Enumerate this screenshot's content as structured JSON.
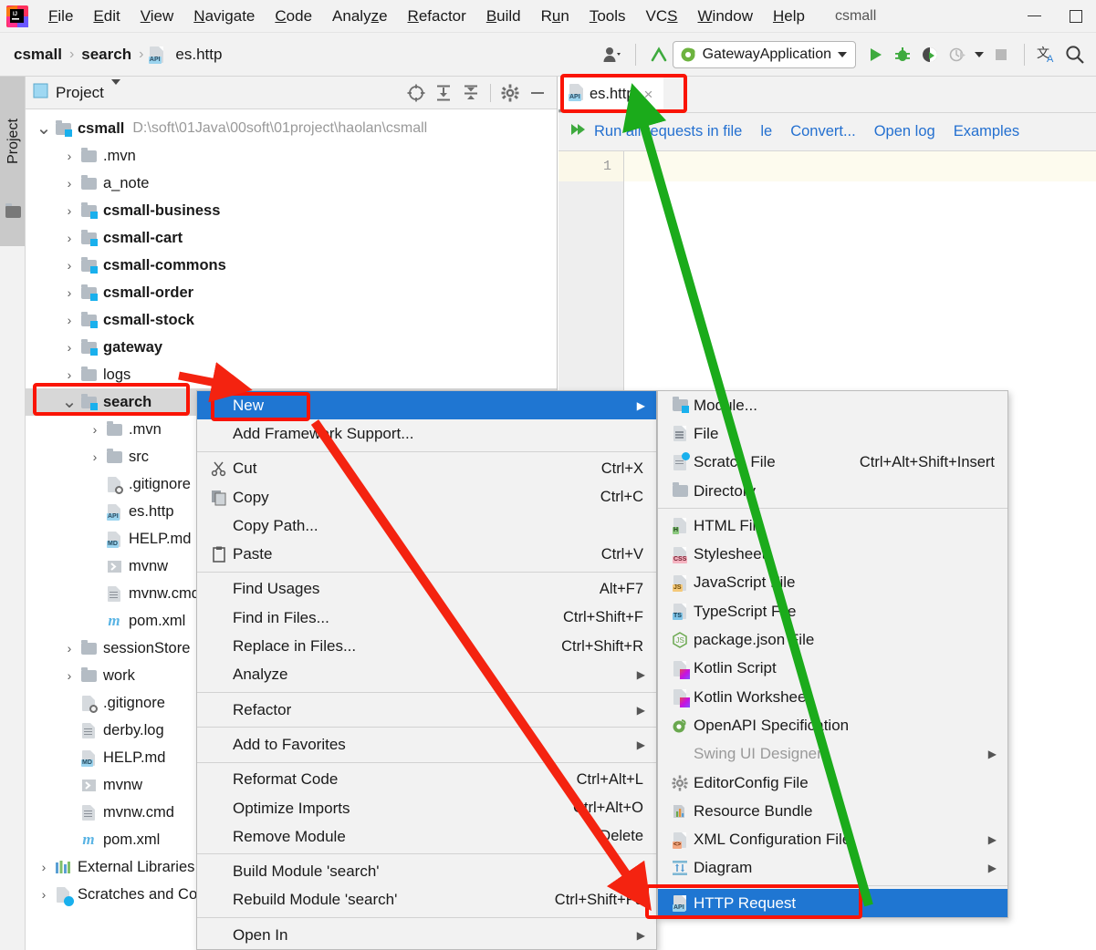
{
  "window": {
    "project_name": "csmall",
    "minimize_label": "—",
    "maximize_label": "□"
  },
  "menubar": {
    "items": [
      {
        "label": "File",
        "mnemonic": "F"
      },
      {
        "label": "Edit",
        "mnemonic": "E"
      },
      {
        "label": "View",
        "mnemonic": "V"
      },
      {
        "label": "Navigate",
        "mnemonic": "N"
      },
      {
        "label": "Code",
        "mnemonic": "C"
      },
      {
        "label": "Analyze",
        "mnemonic": "z"
      },
      {
        "label": "Refactor",
        "mnemonic": "R"
      },
      {
        "label": "Build",
        "mnemonic": "B"
      },
      {
        "label": "Run",
        "mnemonic": "u"
      },
      {
        "label": "Tools",
        "mnemonic": "T"
      },
      {
        "label": "VCS",
        "mnemonic": "S"
      },
      {
        "label": "Window",
        "mnemonic": "W"
      },
      {
        "label": "Help",
        "mnemonic": "H"
      }
    ]
  },
  "navbar": {
    "breadcrumb": [
      "csmall",
      "search",
      "es.http"
    ],
    "breadcrumb_separator": "›",
    "run_config": "GatewayApplication",
    "icons": {
      "profile": "profile-icon",
      "update": "update-project-icon",
      "run": "run-icon",
      "debug": "debug-icon",
      "run_coverage": "run-with-coverage-icon",
      "profiler": "profiler-icon",
      "stop": "stop-icon",
      "translate": "translate-icon",
      "search": "search-everywhere-icon"
    }
  },
  "toolstrip": {
    "project_label": "Project"
  },
  "project_panel": {
    "title": "Project",
    "header_icons": [
      "locate-icon",
      "expand-all-icon",
      "collapse-all-icon",
      "settings-gear-icon",
      "hide-icon"
    ],
    "tree": [
      {
        "depth": 0,
        "twist": "⌄",
        "icon": "module-folder",
        "label": "csmall",
        "bold": true,
        "path": "D:\\soft\\01Java\\00soft\\01project\\haolan\\csmall"
      },
      {
        "depth": 1,
        "twist": "›",
        "icon": "folder",
        "label": ".mvn",
        "bold": false,
        "path": ""
      },
      {
        "depth": 1,
        "twist": "›",
        "icon": "folder",
        "label": "a_note",
        "bold": false,
        "path": ""
      },
      {
        "depth": 1,
        "twist": "›",
        "icon": "module-folder",
        "label": "csmall-business",
        "bold": true,
        "path": ""
      },
      {
        "depth": 1,
        "twist": "›",
        "icon": "module-folder",
        "label": "csmall-cart",
        "bold": true,
        "path": ""
      },
      {
        "depth": 1,
        "twist": "›",
        "icon": "module-folder",
        "label": "csmall-commons",
        "bold": true,
        "path": ""
      },
      {
        "depth": 1,
        "twist": "›",
        "icon": "module-folder",
        "label": "csmall-order",
        "bold": true,
        "path": ""
      },
      {
        "depth": 1,
        "twist": "›",
        "icon": "module-folder",
        "label": "csmall-stock",
        "bold": true,
        "path": ""
      },
      {
        "depth": 1,
        "twist": "›",
        "icon": "module-folder",
        "label": "gateway",
        "bold": true,
        "path": ""
      },
      {
        "depth": 1,
        "twist": "›",
        "icon": "folder",
        "label": "logs",
        "bold": false,
        "path": ""
      },
      {
        "depth": 1,
        "twist": "⌄",
        "icon": "module-folder",
        "label": "search",
        "bold": true,
        "path": "",
        "selected": true
      },
      {
        "depth": 2,
        "twist": "›",
        "icon": "folder",
        "label": ".mvn",
        "bold": false,
        "path": ""
      },
      {
        "depth": 2,
        "twist": "›",
        "icon": "folder",
        "label": "src",
        "bold": false,
        "path": ""
      },
      {
        "depth": 2,
        "twist": "",
        "icon": "gitignore-file",
        "label": ".gitignore",
        "bold": false,
        "path": ""
      },
      {
        "depth": 2,
        "twist": "",
        "icon": "http-file",
        "label": "es.http",
        "bold": false,
        "path": ""
      },
      {
        "depth": 2,
        "twist": "",
        "icon": "md-file",
        "label": "HELP.md",
        "bold": false,
        "path": ""
      },
      {
        "depth": 2,
        "twist": "",
        "icon": "shell-file",
        "label": "mvnw",
        "bold": false,
        "path": ""
      },
      {
        "depth": 2,
        "twist": "",
        "icon": "text-file",
        "label": "mvnw.cmd",
        "bold": false,
        "path": ""
      },
      {
        "depth": 2,
        "twist": "",
        "icon": "maven-file",
        "label": "pom.xml",
        "bold": false,
        "path": ""
      },
      {
        "depth": 1,
        "twist": "›",
        "icon": "folder",
        "label": "sessionStore",
        "bold": false,
        "path": ""
      },
      {
        "depth": 1,
        "twist": "›",
        "icon": "folder",
        "label": "work",
        "bold": false,
        "path": ""
      },
      {
        "depth": 1,
        "twist": "",
        "icon": "gitignore-file",
        "label": ".gitignore",
        "bold": false,
        "path": ""
      },
      {
        "depth": 1,
        "twist": "",
        "icon": "text-file",
        "label": "derby.log",
        "bold": false,
        "path": ""
      },
      {
        "depth": 1,
        "twist": "",
        "icon": "md-file",
        "label": "HELP.md",
        "bold": false,
        "path": ""
      },
      {
        "depth": 1,
        "twist": "",
        "icon": "shell-file",
        "label": "mvnw",
        "bold": false,
        "path": ""
      },
      {
        "depth": 1,
        "twist": "",
        "icon": "text-file",
        "label": "mvnw.cmd",
        "bold": false,
        "path": ""
      },
      {
        "depth": 1,
        "twist": "",
        "icon": "maven-file",
        "label": "pom.xml",
        "bold": false,
        "path": ""
      },
      {
        "depth": 0,
        "twist": "›",
        "icon": "libraries",
        "label": "External Libraries",
        "bold": false,
        "path": ""
      },
      {
        "depth": 0,
        "twist": "›",
        "icon": "scratches",
        "label": "Scratches and Consoles",
        "bold": false,
        "path": ""
      }
    ]
  },
  "editor": {
    "tab": {
      "label": "es.http",
      "icon": "http-file",
      "close": "×"
    },
    "http_toolbar": [
      {
        "label": "Run all requests in file",
        "icon": "run-all-icon"
      },
      {
        "label": "le"
      },
      {
        "label": "Convert..."
      },
      {
        "label": "Open log"
      },
      {
        "label": "Examples"
      }
    ],
    "line_numbers": [
      "1"
    ]
  },
  "context_menu": {
    "items": [
      {
        "label": "New",
        "accel": "",
        "submenu": true,
        "highlighted": true,
        "icon": ""
      },
      {
        "label": "Add Framework Support...",
        "accel": "",
        "icon": ""
      },
      {
        "separator": true
      },
      {
        "label": "Cut",
        "accel": "Ctrl+X",
        "icon": "scissors-icon"
      },
      {
        "label": "Copy",
        "accel": "Ctrl+C",
        "icon": "copy-icon"
      },
      {
        "label": "Copy Path...",
        "accel": "",
        "icon": ""
      },
      {
        "label": "Paste",
        "accel": "Ctrl+V",
        "icon": "paste-icon"
      },
      {
        "separator": true
      },
      {
        "label": "Find Usages",
        "accel": "Alt+F7",
        "icon": ""
      },
      {
        "label": "Find in Files...",
        "accel": "Ctrl+Shift+F",
        "icon": ""
      },
      {
        "label": "Replace in Files...",
        "accel": "Ctrl+Shift+R",
        "icon": ""
      },
      {
        "label": "Analyze",
        "accel": "",
        "submenu": true,
        "icon": ""
      },
      {
        "separator": true
      },
      {
        "label": "Refactor",
        "accel": "",
        "submenu": true,
        "icon": ""
      },
      {
        "separator": true
      },
      {
        "label": "Add to Favorites",
        "accel": "",
        "submenu": true,
        "icon": ""
      },
      {
        "separator": true
      },
      {
        "label": "Reformat Code",
        "accel": "Ctrl+Alt+L",
        "icon": ""
      },
      {
        "label": "Optimize Imports",
        "accel": "Ctrl+Alt+O",
        "icon": ""
      },
      {
        "label": "Remove Module",
        "accel": "Delete",
        "icon": ""
      },
      {
        "separator": true
      },
      {
        "label": "Build Module 'search'",
        "accel": "",
        "icon": ""
      },
      {
        "label": "Rebuild Module 'search'",
        "accel": "Ctrl+Shift+F9",
        "icon": ""
      },
      {
        "separator": true
      },
      {
        "label": "Open In",
        "accel": "",
        "submenu": true,
        "icon": ""
      }
    ]
  },
  "submenu": {
    "items": [
      {
        "label": "Module...",
        "accel": "",
        "icon": "module-folder"
      },
      {
        "label": "File",
        "accel": "",
        "icon": "text-file"
      },
      {
        "label": "Scratch File",
        "accel": "Ctrl+Alt+Shift+Insert",
        "icon": "scratch-file"
      },
      {
        "label": "Directory",
        "accel": "",
        "icon": "folder"
      },
      {
        "separator": true
      },
      {
        "label": "HTML File",
        "accel": "",
        "icon": "html-file"
      },
      {
        "label": "Stylesheet",
        "accel": "",
        "icon": "css-file"
      },
      {
        "label": "JavaScript File",
        "accel": "",
        "icon": "js-file"
      },
      {
        "label": "TypeScript File",
        "accel": "",
        "icon": "ts-file"
      },
      {
        "label": "package.json File",
        "accel": "",
        "icon": "node-file"
      },
      {
        "label": "Kotlin Script",
        "accel": "",
        "icon": "kotlin-file"
      },
      {
        "label": "Kotlin Worksheet",
        "accel": "",
        "icon": "kotlin-file"
      },
      {
        "label": "OpenAPI Specification",
        "accel": "",
        "icon": "openapi-icon"
      },
      {
        "label": "Swing UI Designer",
        "accel": "",
        "submenu": true,
        "dim": true,
        "icon": ""
      },
      {
        "label": "EditorConfig File",
        "accel": "",
        "icon": "gear-icon"
      },
      {
        "label": "Resource Bundle",
        "accel": "",
        "icon": "resource-bundle-icon"
      },
      {
        "label": "XML Configuration File",
        "accel": "",
        "submenu": true,
        "icon": "xml-file"
      },
      {
        "label": "Diagram",
        "accel": "",
        "submenu": true,
        "icon": "diagram-icon"
      },
      {
        "separator": true
      },
      {
        "label": "HTTP Request",
        "accel": "",
        "icon": "http-file",
        "highlighted": true
      }
    ]
  },
  "annotations": {
    "highlight_color": "#fa1405",
    "arrow_red_color": "#f42310",
    "arrow_green_color": "#1bab1b",
    "red_boxes": [
      {
        "name": "search-module-highlight"
      },
      {
        "name": "new-menu-item-highlight"
      },
      {
        "name": "http-request-item-highlight"
      },
      {
        "name": "es-http-tab-highlight"
      }
    ]
  }
}
